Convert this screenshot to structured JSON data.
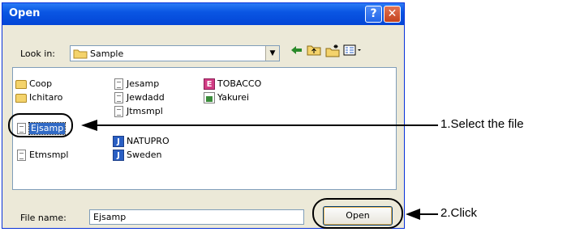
{
  "dialog": {
    "title": "Open",
    "help_button": "?",
    "close_button": "✕"
  },
  "toolbar": {
    "look_in_label": "Look in:",
    "look_in_value": "Sample"
  },
  "files": [
    {
      "name": "Coop",
      "type": "folder"
    },
    {
      "name": "Ichitaro",
      "type": "folder"
    },
    {
      "name": "Jesamp",
      "type": "doc"
    },
    {
      "name": "Jewdadd",
      "type": "doc"
    },
    {
      "name": "Jtmsmpl",
      "type": "doc"
    },
    {
      "name": "Ejsamp",
      "type": "doc",
      "selected": true
    },
    {
      "name": "NATUPRO",
      "type": "j-app"
    },
    {
      "name": "Sweden",
      "type": "j-app"
    },
    {
      "name": "Etmsmpl",
      "type": "doc"
    },
    {
      "name": "TOBACCO",
      "type": "e-app"
    },
    {
      "name": "Yakurei",
      "type": "sheet"
    }
  ],
  "bottom": {
    "file_name_label": "File name:",
    "file_name_value": "Ejsamp",
    "open_label": "Open"
  },
  "callouts": {
    "step1": "1.Select the file",
    "step2": "2.Click"
  },
  "colors": {
    "titlebar": "#0a56e3",
    "selection": "#316ac5",
    "dialog_bg": "#ece9d8"
  }
}
